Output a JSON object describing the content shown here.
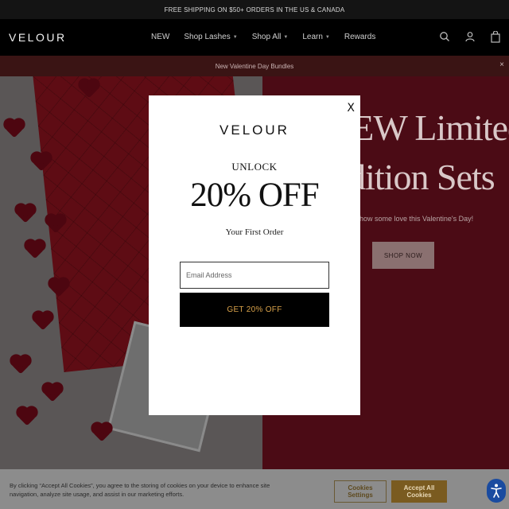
{
  "announcement": {
    "text": "FREE SHIPPING ON $50+ ORDERS IN THE US & CANADA"
  },
  "brand": {
    "logo_text": "VELOUR"
  },
  "nav": {
    "items": [
      {
        "label": "NEW",
        "has_dropdown": false
      },
      {
        "label": "Shop Lashes",
        "has_dropdown": true
      },
      {
        "label": "Shop All",
        "has_dropdown": true
      },
      {
        "label": "Learn",
        "has_dropdown": true
      },
      {
        "label": "Rewards",
        "has_dropdown": false
      }
    ],
    "icons": [
      "search-icon",
      "account-icon",
      "bag-icon"
    ]
  },
  "promo_bar": {
    "text": "New Valentine Day Bundles",
    "close_label": "×"
  },
  "hero": {
    "title_line1": "NEW Limited",
    "title_line2": "Edition Sets",
    "subtitle": "Show some love this Valentine's Day!",
    "button_label": "SHOP NOW"
  },
  "modal": {
    "close_label": "X",
    "logo_text": "VELOUR",
    "unlock_text": "UNLOCK",
    "offer_text": "20% OFF",
    "subheading": "Your First Order",
    "email_placeholder": "Email Address",
    "email_value": "",
    "submit_label": "GET 20% OFF"
  },
  "cookie_banner": {
    "text": "By clicking “Accept All Cookies”, you agree to the storing of cookies on your device to enhance site navigation, analyze site usage, and assist in our marketing efforts.",
    "settings_label": "Cookies Settings",
    "accept_label": "Accept All Cookies"
  },
  "colors": {
    "accent_gold": "#d9a24a",
    "hero_red": "#4b0b15",
    "accept_button": "#7a5b20"
  }
}
